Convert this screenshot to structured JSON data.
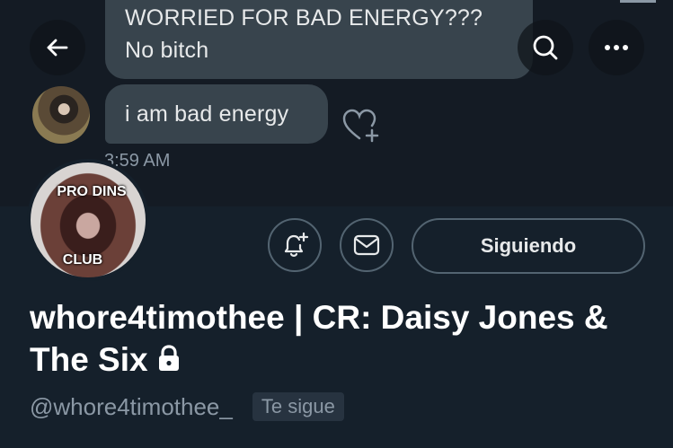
{
  "dm": {
    "message_1_line_1": "WORRIED FOR BAD ENERGY???",
    "message_1_line_2": "No bitch",
    "message_2": "i am bad energy",
    "time": "3:59 AM"
  },
  "nav": {
    "back_icon": "arrow-left-icon",
    "search_icon": "search-icon",
    "more_icon": "more-horizontal-icon"
  },
  "avatar": {
    "text_top": "PRO DINS",
    "text_bottom": "CLUB"
  },
  "actions": {
    "notify_icon": "bell-plus-icon",
    "message_icon": "envelope-icon",
    "follow_label": "Siguiendo"
  },
  "profile": {
    "display_name": "whore4timothee | CR: Daisy Jones & The Six",
    "handle": "@whore4timothee_",
    "follows_you": "Te sigue",
    "protected_icon": "lock-icon"
  },
  "colors": {
    "background": "#15202b",
    "bubble": "#38444d",
    "secondary_text": "#8b98a5",
    "border": "#536471"
  }
}
